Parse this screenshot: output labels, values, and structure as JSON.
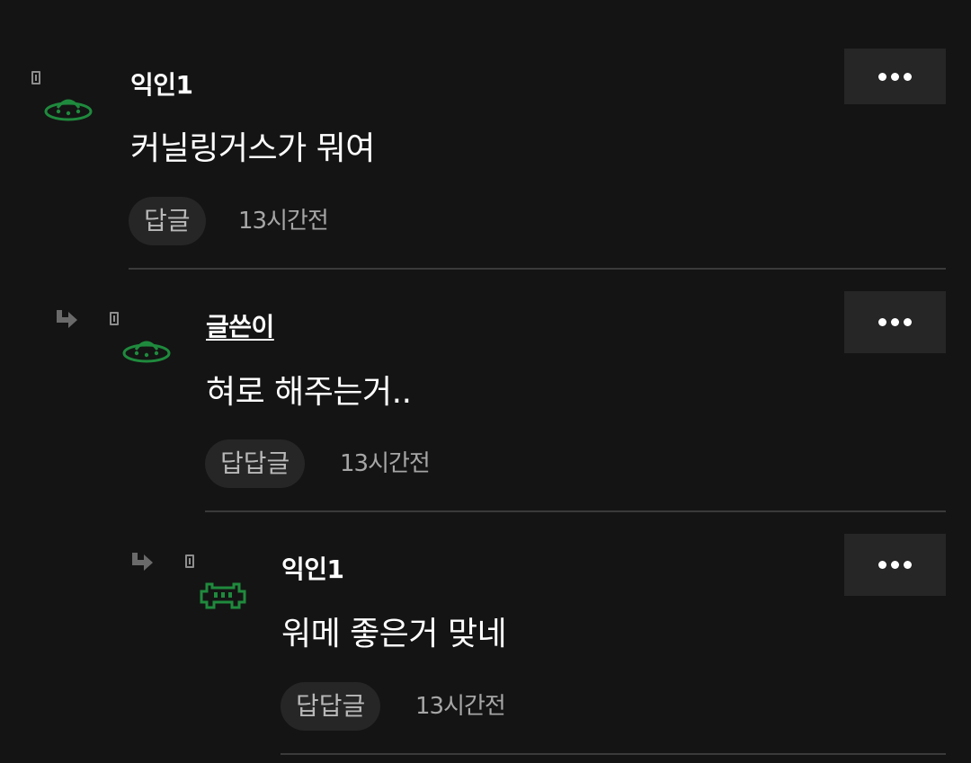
{
  "comments": [
    {
      "author": "익인1",
      "text": "커닐링거스가 뭐여",
      "reply_label": "답글",
      "time": "13시간전",
      "avatar": "ufo-icon"
    },
    {
      "author": "글쓴이",
      "text": "혀로 해주는거..",
      "reply_label": "답답글",
      "time": "13시간전",
      "avatar": "ufo-icon"
    },
    {
      "author": "익인1",
      "text": "워메 좋은거 맞네",
      "reply_label": "답답글",
      "time": "13시간전",
      "avatar": "space-invader-icon"
    }
  ],
  "colors": {
    "background": "#141414",
    "avatar_green": "#1f8a3d",
    "button_bg": "#262626",
    "muted_text": "#a6a6a6"
  }
}
